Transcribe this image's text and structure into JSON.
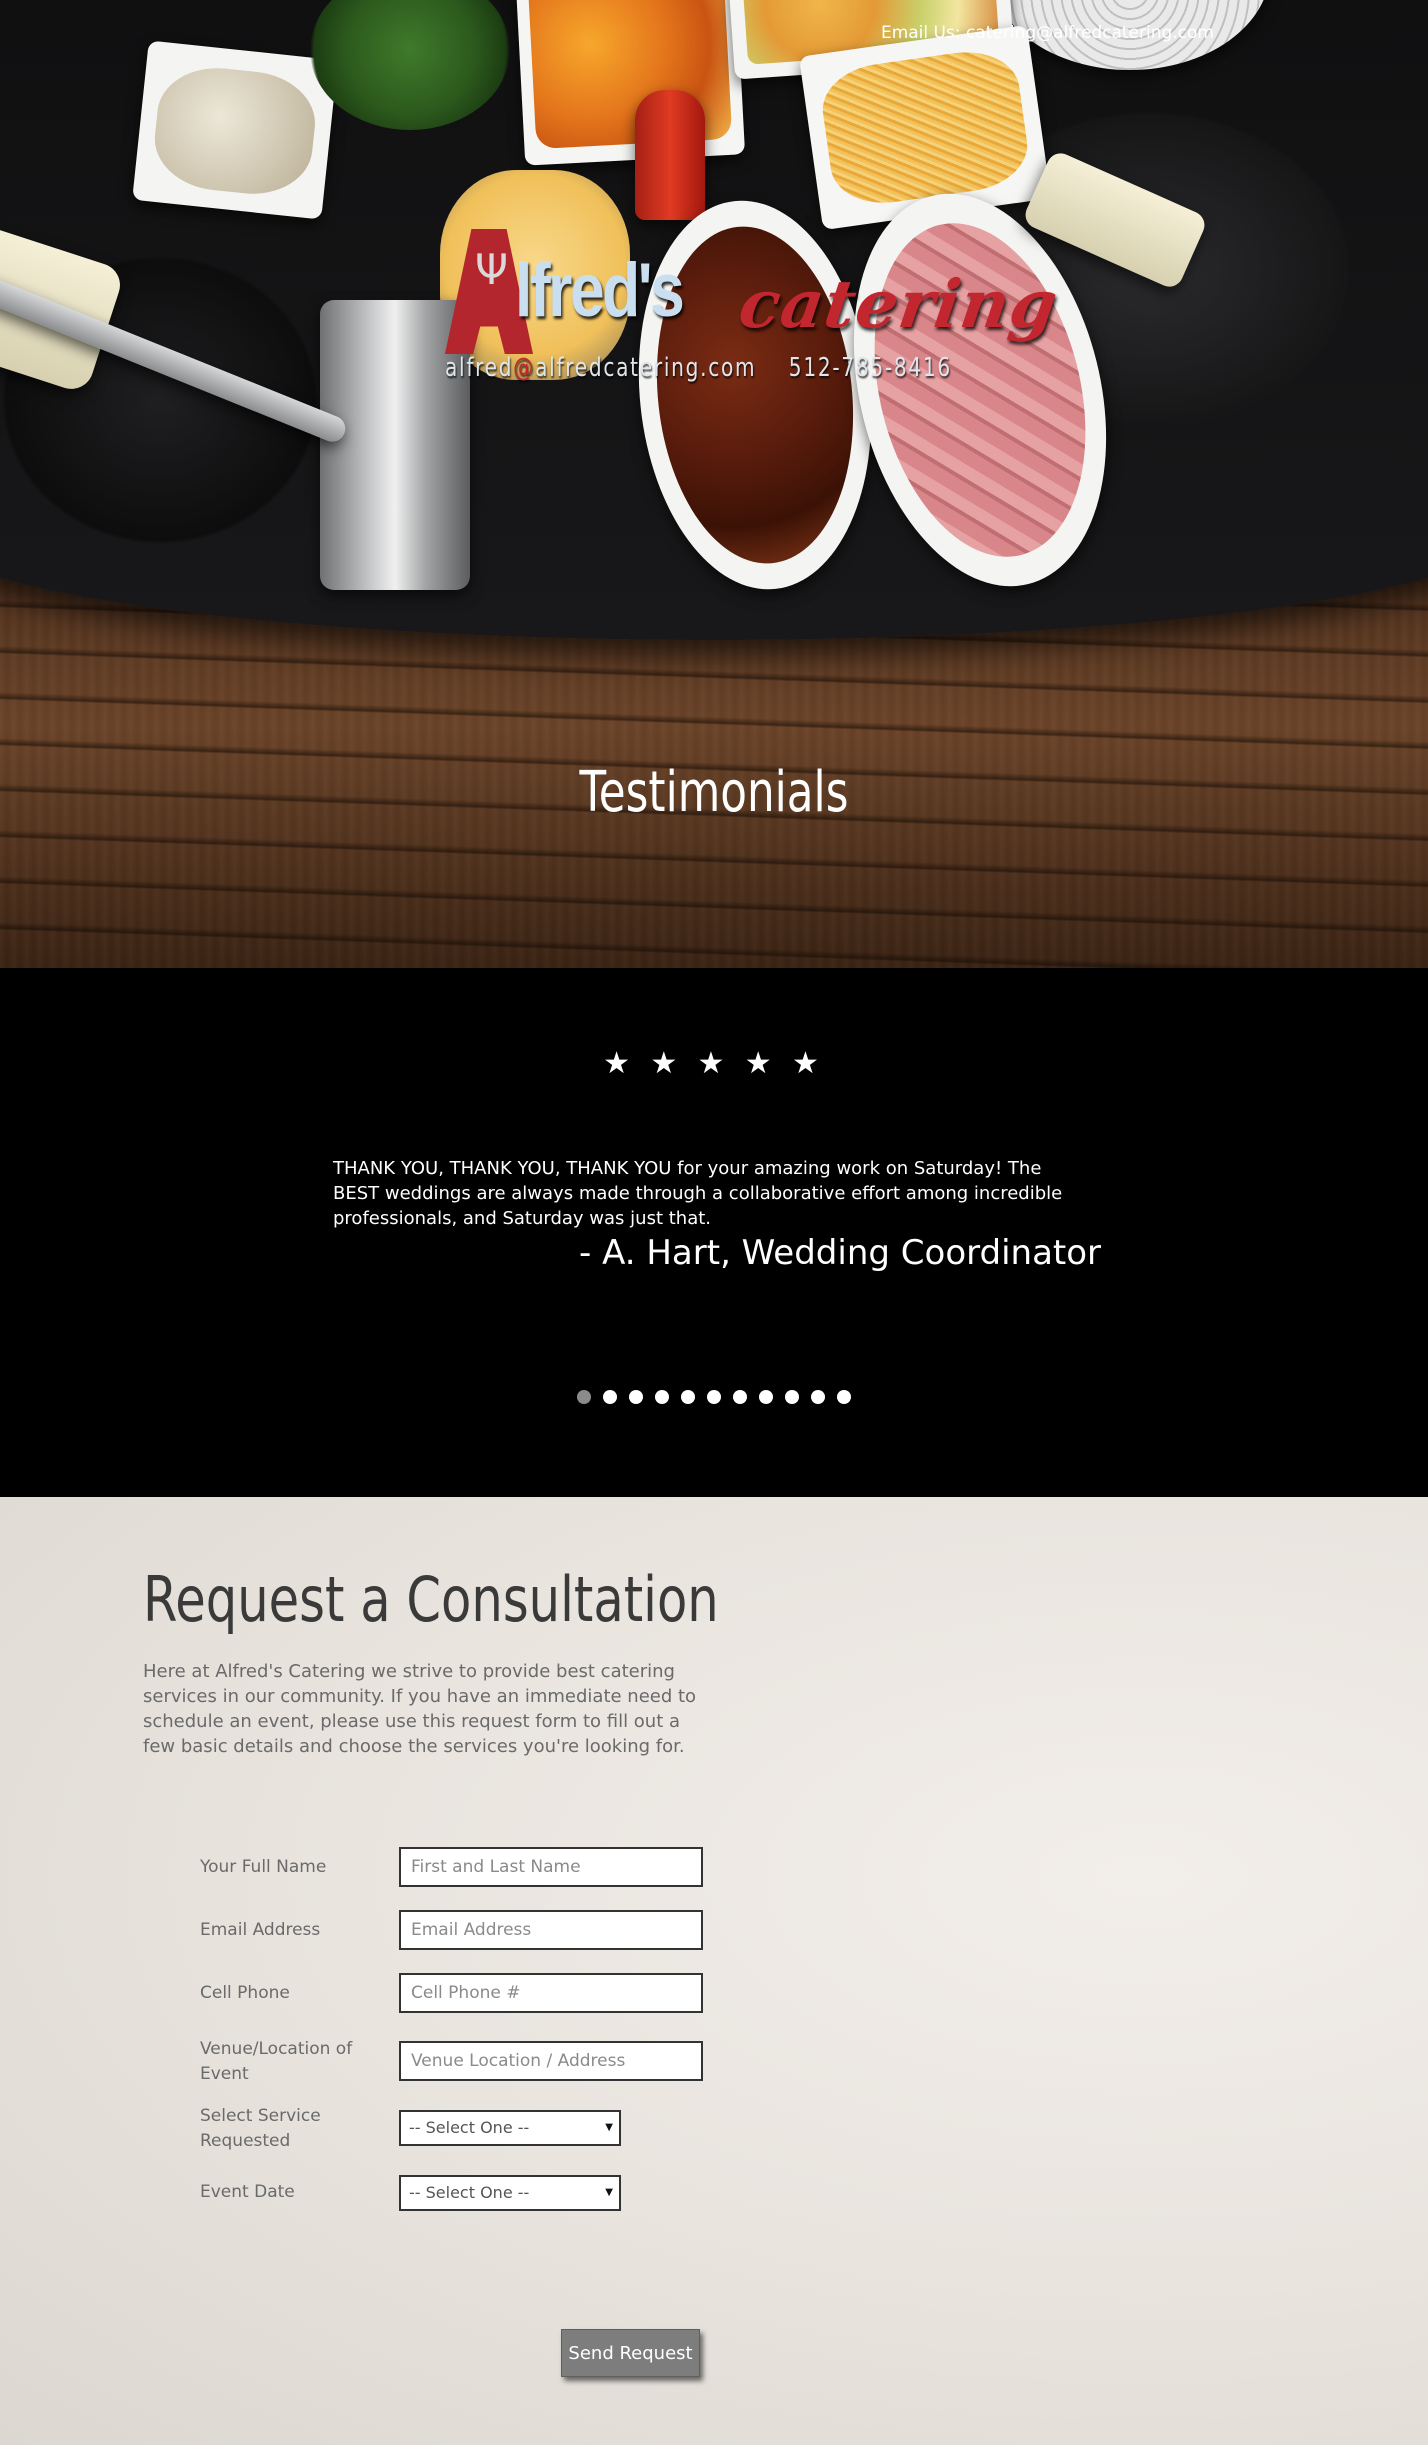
{
  "header": {
    "email_text": "Email Us: catering@alfredcatering.com"
  },
  "logo": {
    "letter_a": "A",
    "fork_glyph": "Ψ",
    "name": "lfred's",
    "tagline": "catering",
    "email_part1": "alfred",
    "email_at": "@",
    "email_part2": "alfredcatering.com",
    "phone": "512-785-8416"
  },
  "testimonials": {
    "title": "Testimonials",
    "rating": "★ ★ ★ ★ ★",
    "stars_count": 5,
    "quote": "THANK YOU, THANK YOU, THANK YOU for your amazing work on Saturday! The BEST weddings are always made through a collaborative effort among incredible professionals, and Saturday was just that.",
    "author": "- A. Hart, Wedding Coordinator",
    "slide_count": 11,
    "active_slide": 1
  },
  "consultation": {
    "title": "Request a Consultation",
    "intro": "Here at Alfred's Catering we strive to provide best catering services in our community. If you have an immediate need to schedule an event, please use this request form to fill out a few basic details and choose the services you're looking for.",
    "fields": {
      "name": {
        "label": "Your Full Name",
        "placeholder": "First and Last Name"
      },
      "email": {
        "label": "Email Address",
        "placeholder": "Email Address"
      },
      "phone": {
        "label": "Cell Phone",
        "placeholder": "Cell Phone #"
      },
      "venue": {
        "label": "Venue/Location of Event",
        "placeholder": "Venue Location / Address"
      },
      "service": {
        "label": "Select Service Requested",
        "selected": "-- Select One --"
      },
      "date": {
        "label": "Event Date",
        "selected": "-- Select One --"
      }
    },
    "submit_label": "Send Request"
  },
  "colors": {
    "brand_red": "#c2262e",
    "logo_blue": "#c9dff0",
    "button_gray": "#7d7d7d",
    "active_dot": "#8b8b8b"
  }
}
